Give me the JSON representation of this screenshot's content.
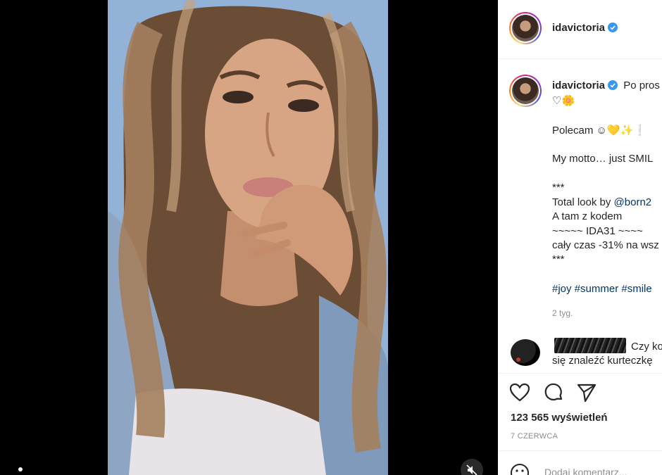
{
  "post": {
    "username": "idavictoria",
    "verified_icon": "verified-badge-icon",
    "caption_head": "Po pros",
    "caption_emojis": "♡🌼",
    "lines": {
      "polecam": "Polecam ☺💛✨❕",
      "motto": "My motto… just SMIL",
      "stars1": "***",
      "total_look_prefix": "Total look by ",
      "total_look_link": "@born2",
      "a_tam": "A tam z kodem",
      "code": "~~~~~ IDA31 ~~~~",
      "discount": "cały czas -31% na wsz",
      "stars2": "***",
      "hashtags": "#joy #summer #smile"
    },
    "time_ago": "2 tyg."
  },
  "comment": {
    "text_line1": "Czy ko",
    "text_line2": "się znaleźć kurteczkę"
  },
  "stats": {
    "views": "123 565 wyświetleń",
    "date": "7 CZERWCA"
  },
  "add_comment": {
    "placeholder": "Dodaj komentarz..."
  },
  "colors": {
    "link": "#00376b",
    "verified": "#3897f0",
    "muted": "#8e8e8e",
    "text": "#262626"
  }
}
